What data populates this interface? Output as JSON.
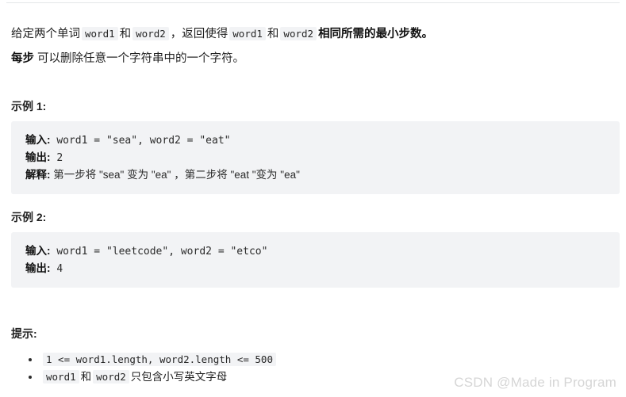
{
  "document": {
    "top_rule": true,
    "intro": {
      "prefix": "给定两个单词",
      "code1": "word1",
      "conj1": "和",
      "code2": "word2",
      "middle": "，返回使得",
      "code3": "word1",
      "conj2": "和",
      "code4": "word2",
      "suffix_normal": "相同所需的",
      "suffix_bold": "最小步数。"
    },
    "step_note": {
      "bold": "每步",
      "text": "可以删除任意一个字符串中的一个字符。"
    },
    "examples": [
      {
        "heading": "示例 1:",
        "lines": [
          {
            "label": "输入:",
            "value": " word1 = \"sea\", word2 = \"eat\"",
            "is_code": true
          },
          {
            "label": "输出:",
            "value": " 2",
            "is_code": true
          },
          {
            "label": "解释:",
            "value": " 第一步将 \"sea\" 变为 \"ea\" ，第二步将 \"eat \"变为 \"ea\"",
            "is_code": false
          }
        ]
      },
      {
        "heading": "示例 2:",
        "lines": [
          {
            "label": "输入:",
            "value": " word1 = \"leetcode\", word2 = \"etco\"",
            "is_code": true
          },
          {
            "label": "输出:",
            "value": " 4",
            "is_code": true
          }
        ]
      }
    ],
    "hints": {
      "heading": "提示:",
      "items": [
        {
          "type": "code-only",
          "code": "1 <= word1.length, word2.length <= 500"
        },
        {
          "type": "mixed",
          "code1": "word1",
          "conj": "和",
          "code2": "word2",
          "tail": "只包含小写英文字母"
        }
      ]
    },
    "watermark": "CSDN @Made in Program",
    "colors": {
      "page_background": "#ffffff",
      "code_block_background": "#f2f3f5",
      "inline_code_background": "#f2f3f5",
      "text": "#1f1f1f",
      "rule": "#e4e6e8",
      "watermark": "#d6d6d6"
    }
  }
}
